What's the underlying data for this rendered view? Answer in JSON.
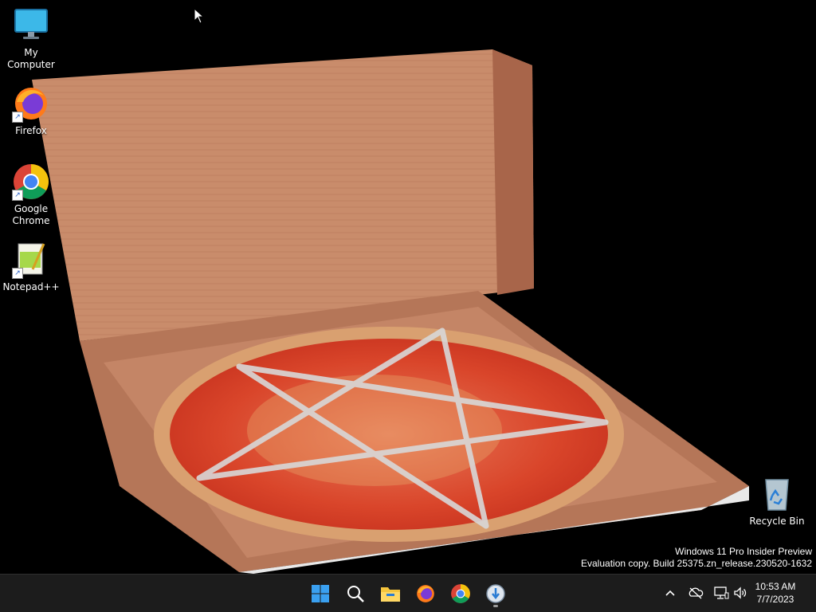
{
  "desktop": {
    "icons": [
      {
        "label": "My Computer",
        "icon": "computer-icon"
      },
      {
        "label": "Firefox",
        "icon": "firefox-icon"
      },
      {
        "label": "Google Chrome",
        "icon": "chrome-icon"
      },
      {
        "label": "Notepad++",
        "icon": "notepadpp-icon"
      },
      {
        "label": "Recycle Bin",
        "icon": "recycle-bin-icon"
      }
    ],
    "wallpaper": "pizza-box-wallpaper"
  },
  "watermark": {
    "line1": "Windows 11 Pro Insider Preview",
    "line2": "Evaluation copy. Build 25375.zn_release.230520-1632"
  },
  "taskbar": {
    "pinned": [
      "start-icon",
      "search-icon",
      "file-explorer-icon",
      "firefox-icon",
      "chrome-icon",
      "installer-icon"
    ],
    "tray": [
      "chevron-up-icon",
      "cloud-offline-icon",
      "network-icon",
      "volume-icon"
    ],
    "time": "10:53 AM",
    "date": "7/7/2023"
  },
  "colors": {
    "taskbar_bg": "#1c1c1c",
    "box": "#c98a6a",
    "sauce": "#d8331f"
  }
}
